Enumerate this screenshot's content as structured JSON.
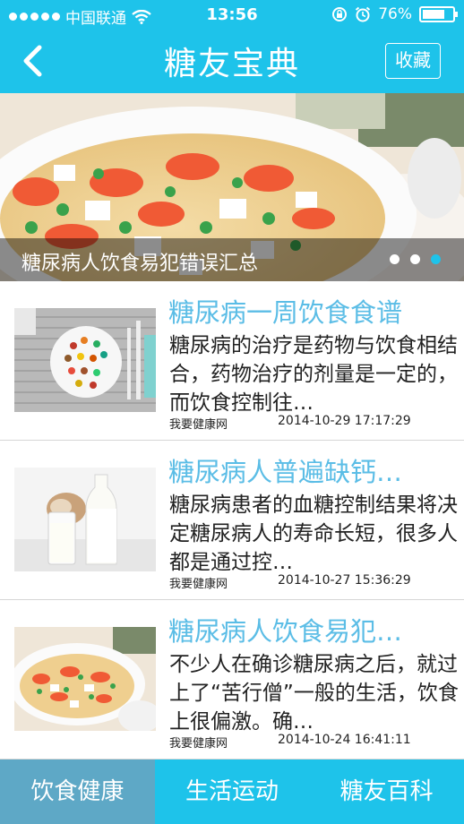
{
  "status_bar": {
    "carrier": "中国联通",
    "time": "13:56",
    "battery": "76%",
    "battery_level": 0.76
  },
  "nav": {
    "title": "糖友宝典",
    "favorite_label": "收藏",
    "back_icon": "chevron-left-icon"
  },
  "banner": {
    "caption": "糖尿病人饮食易犯错误汇总",
    "page_count": 3,
    "active_page": 3
  },
  "articles": [
    {
      "title": "糖尿病一周饮食食谱",
      "summary": "糖尿病的治疗是药物与饮食相结合，药物治疗的剂量是一定的，而饮食控制往…",
      "source": "我要健康网",
      "date": "2014-10-29 17:17:29"
    },
    {
      "title": "糖尿病人普遍缺钙…",
      "summary": "糖尿病患者的血糖控制结果将决定糖尿病人的寿命长短，很多人都是通过控…",
      "source": "我要健康网",
      "date": "2014-10-27 15:36:29"
    },
    {
      "title": "糖尿病人饮食易犯…",
      "summary": "不少人在确诊糖尿病之后，就过上了“苦行僧”一般的生活，饮食上很偏激。确…",
      "source": "我要健康网",
      "date": "2014-10-24 16:41:11"
    }
  ],
  "tabs": [
    {
      "label": "饮食健康",
      "active": true
    },
    {
      "label": "生活运动",
      "active": false
    },
    {
      "label": "糖友百科",
      "active": false
    }
  ],
  "colors": {
    "primary": "#1ec3ea",
    "title_blue": "#5bbde6",
    "tab_active": "#5ea8c6"
  }
}
